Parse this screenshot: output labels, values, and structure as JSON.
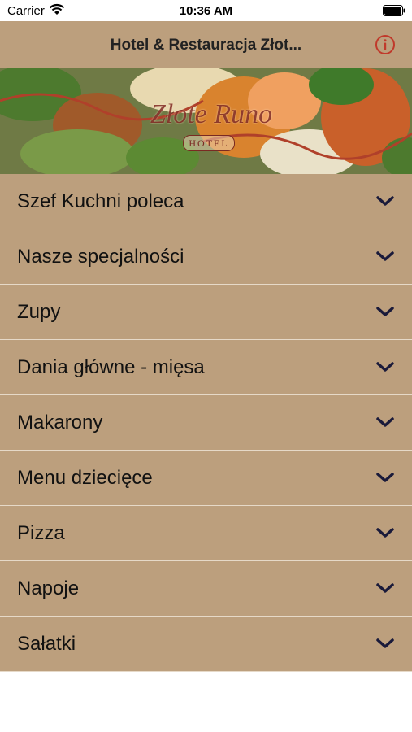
{
  "status_bar": {
    "carrier": "Carrier",
    "time": "10:36 AM"
  },
  "nav": {
    "title": "Hotel & Restauracja Złot..."
  },
  "banner": {
    "logo_text": "Złote Runo",
    "logo_sub": "HOTEL"
  },
  "menu": [
    {
      "label": "Szef Kuchni poleca"
    },
    {
      "label": "Nasze specjalności"
    },
    {
      "label": "Zupy"
    },
    {
      "label": "Dania główne - mięsa"
    },
    {
      "label": "Makarony"
    },
    {
      "label": "Menu dziecięce"
    },
    {
      "label": "Pizza"
    },
    {
      "label": "Napoje"
    },
    {
      "label": "Sałatki"
    }
  ],
  "colors": {
    "accent": "#bc9f7d",
    "info_icon": "#c0392b",
    "chevron": "#1a1a3a"
  }
}
